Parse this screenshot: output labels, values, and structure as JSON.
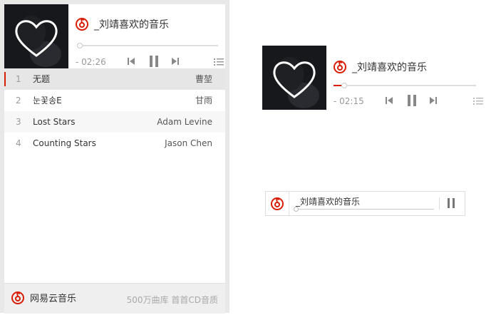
{
  "large_player": {
    "title": "_刘靖喜欢的音乐",
    "time": "- 02:26",
    "tracks": [
      {
        "num": "1",
        "title": "无题",
        "artist": "曹堃"
      },
      {
        "num": "2",
        "title": "눈꽃송E",
        "artist": "甘雨"
      },
      {
        "num": "3",
        "title": "Lost Stars",
        "artist": "Adam Levine"
      },
      {
        "num": "4",
        "title": "Counting Stars",
        "artist": "Jason Chen"
      }
    ],
    "active_track_index": 0,
    "progress": 0.0,
    "footer": {
      "brand": "网易云音乐",
      "note": "500万曲库 首首CD音质"
    }
  },
  "medium_player": {
    "title": "_刘靖喜欢的音乐",
    "time": "- 02:15",
    "progress": 0.07
  },
  "mini_player": {
    "title": "_刘靖喜欢的音乐",
    "progress": 0.0
  },
  "colors": {
    "brand_red": "#d81e06",
    "cover_bg": "#17181c",
    "icon_gray": "#888888"
  },
  "icons": {
    "logo": "netease-cloud-music-logo",
    "prev": "skip-previous-icon",
    "pause": "pause-icon",
    "next": "skip-next-icon",
    "list": "playlist-icon"
  }
}
